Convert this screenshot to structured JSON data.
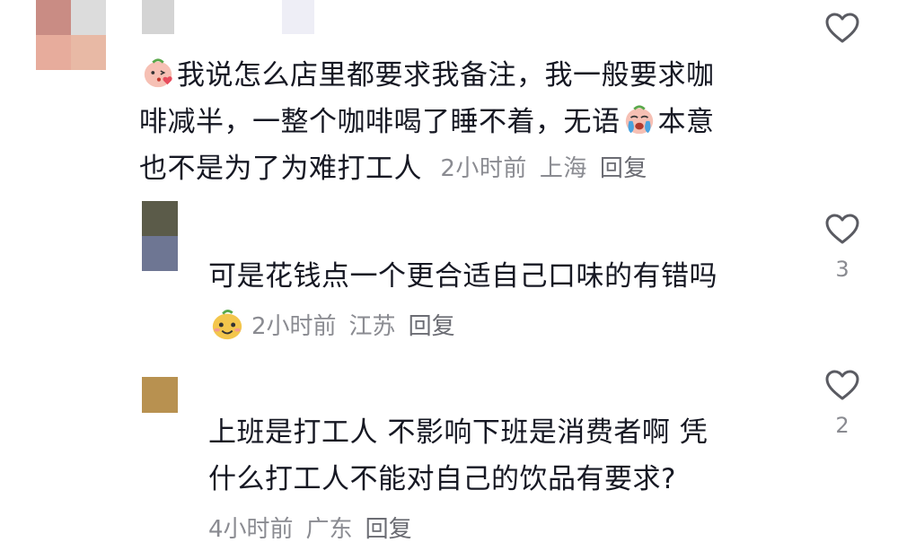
{
  "comments": [
    {
      "lines": [
        "我说怎么店里都要求我备注，我一般要求咖",
        "啡减半，一整个咖啡喝了睡不着，无语",
        "本意",
        "也不是为了为难打工人"
      ],
      "time": "2小时前",
      "location": "上海",
      "reply_label": "回复",
      "like_count": ""
    },
    {
      "lines": [
        "可是花钱点一个更合适自己口味的有错吗"
      ],
      "time": "2小时前",
      "location": "江苏",
      "reply_label": "回复",
      "like_count": "3"
    },
    {
      "lines": [
        "上班是打工人 不影响下班是消费者啊 凭",
        "什么打工人不能对自己的饮品有要求?"
      ],
      "time": "4小时前",
      "location": "广东",
      "reply_label": "回复",
      "like_count": "2"
    }
  ],
  "icons": {
    "like": "heart-outline-icon",
    "emoji_1": "blowing-kiss-emoji-icon",
    "emoji_2": "crying-emoji-icon",
    "emoji_3": "smiling-mango-emoji-icon"
  },
  "colors": {
    "text": "#161823",
    "meta": "#8a8b91",
    "icon": "#5a5b62"
  }
}
